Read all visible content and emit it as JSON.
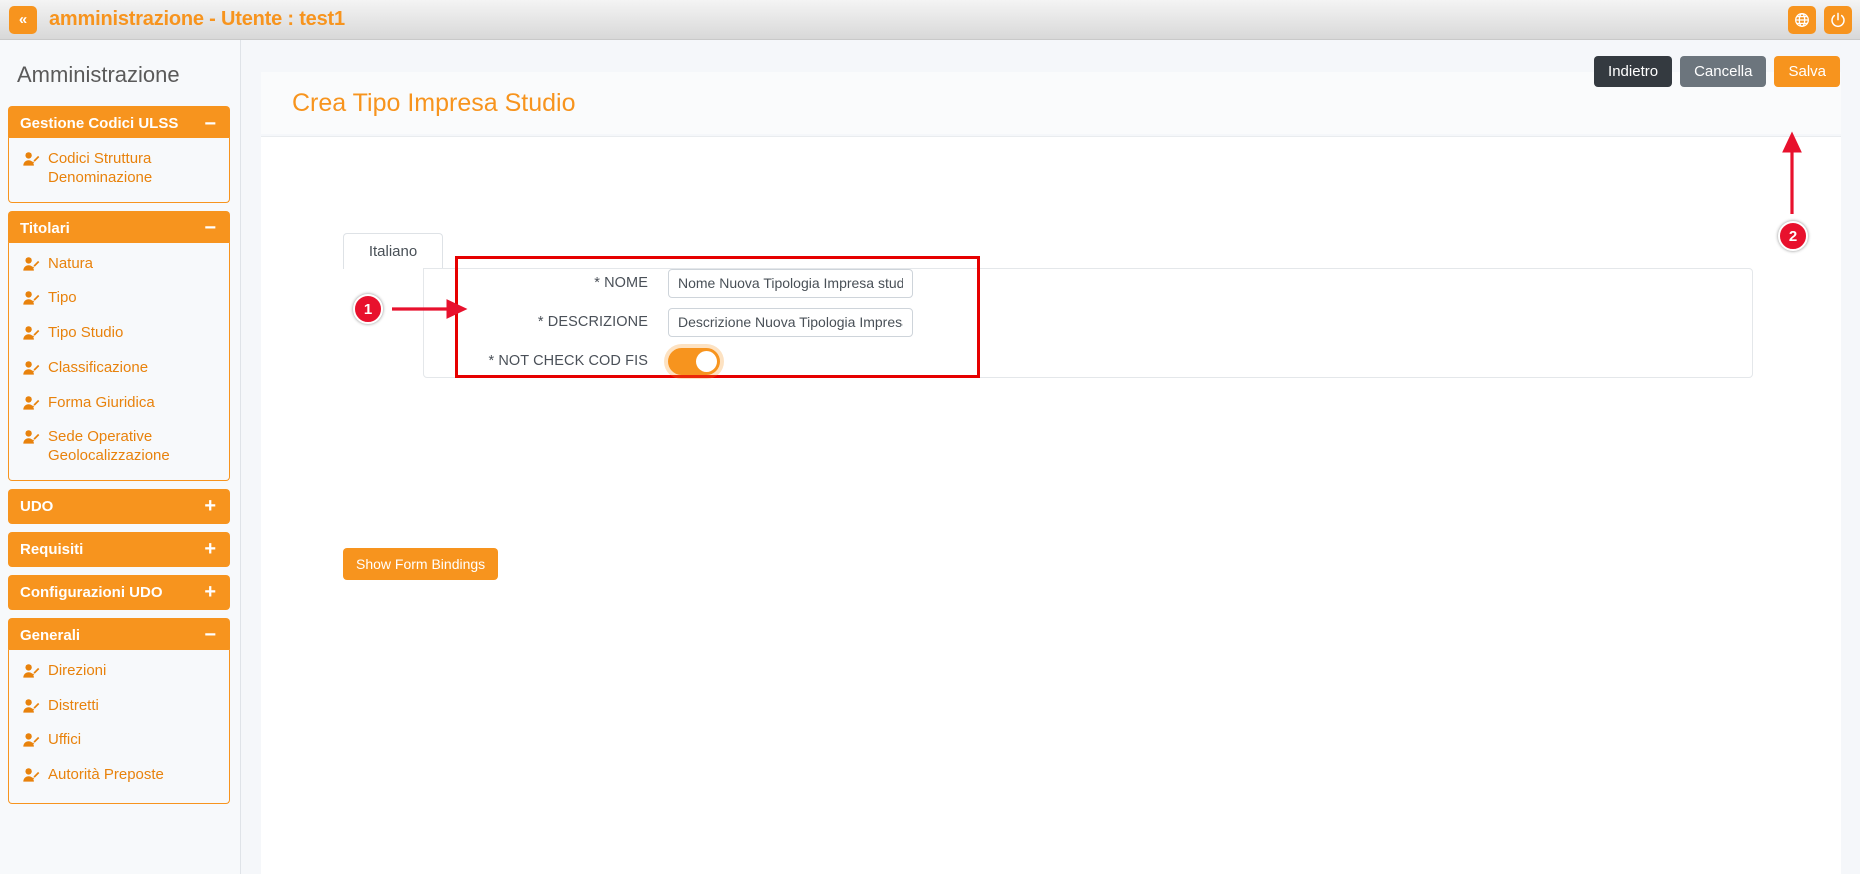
{
  "topbar": {
    "collapse_icon": "chevron-double-left-icon",
    "title": "amministrazione - Utente : test1",
    "language_icon": "globe-icon",
    "logout_icon": "power-icon"
  },
  "sidebar": {
    "title": "Amministrazione",
    "groups": [
      {
        "label": "Gestione Codici ULSS",
        "state": "expanded",
        "toggle": "−",
        "items": [
          {
            "label": "Codici Struttura Denominazione",
            "icon": "user-edit-icon"
          }
        ]
      },
      {
        "label": "Titolari",
        "state": "expanded",
        "toggle": "−",
        "items": [
          {
            "label": "Natura",
            "icon": "user-edit-icon"
          },
          {
            "label": "Tipo",
            "icon": "user-edit-icon"
          },
          {
            "label": "Tipo Studio",
            "icon": "user-edit-icon"
          },
          {
            "label": "Classificazione",
            "icon": "user-edit-icon"
          },
          {
            "label": "Forma Giuridica",
            "icon": "user-edit-icon"
          },
          {
            "label": "Sede Operative Geolocalizzazione",
            "icon": "user-edit-icon"
          }
        ]
      },
      {
        "label": "UDO",
        "state": "collapsed",
        "toggle": "+",
        "items": []
      },
      {
        "label": "Requisiti",
        "state": "collapsed",
        "toggle": "+",
        "items": []
      },
      {
        "label": "Configurazioni UDO",
        "state": "collapsed",
        "toggle": "+",
        "items": []
      },
      {
        "label": "Generali",
        "state": "expanded",
        "toggle": "−",
        "items": [
          {
            "label": "Direzioni",
            "icon": "user-edit-icon"
          },
          {
            "label": "Distretti",
            "icon": "user-edit-icon"
          },
          {
            "label": "Uffici",
            "icon": "user-edit-icon"
          },
          {
            "label": "Autorità Preposte",
            "icon": "user-edit-icon"
          }
        ]
      }
    ]
  },
  "page": {
    "title": "Crea Tipo Impresa Studio",
    "actions": {
      "back": "Indietro",
      "cancel": "Cancella",
      "save": "Salva"
    }
  },
  "form": {
    "tab": "Italiano",
    "fields": [
      {
        "label": "* NOME",
        "value": "Nome Nuova Tipologia Impresa studi",
        "type": "text"
      },
      {
        "label": "* DESCRIZIONE",
        "value": "Descrizione Nuova Tipologia Impresa",
        "type": "text"
      },
      {
        "label": "* NOT CHECK COD FIS",
        "value": "on",
        "type": "toggle"
      }
    ],
    "show_bindings": "Show Form Bindings"
  },
  "annotations": [
    {
      "id": "1",
      "target": "form-box"
    },
    {
      "id": "2",
      "target": "save-button"
    }
  ],
  "colors": {
    "accent": "#f7941e",
    "annotation": "#e8112d",
    "dark_button": "#343a40",
    "grey_button": "#6c757d"
  }
}
